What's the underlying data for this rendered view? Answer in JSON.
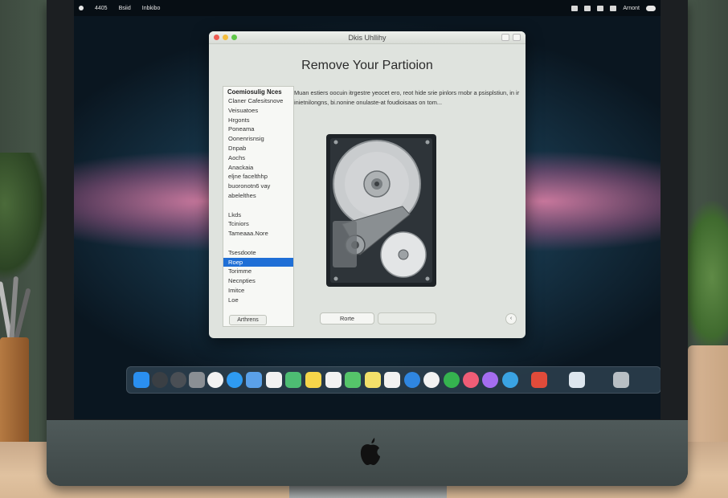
{
  "menubar": {
    "left_items": [
      "4405",
      "Bsiid",
      "Inbkibo"
    ],
    "right_text": "Arnont"
  },
  "window": {
    "title": "Dkis Uhllihy",
    "heading": "Remove Your Partioion",
    "description": "Muan estiers oocuin itrgestre yeocet ero, reot hide srie pinlors rnobr a psisplstiun, in ir inietnilongns, bi.nonine onulaste-at foudioisaas on tom...",
    "sidebar": {
      "header": "Coemiosulig Nces",
      "items": [
        "Claner Cafesitsnove",
        "Veisuatoes",
        "Hrgonts",
        "Poneama",
        "Oonenrisnsig",
        "Dnpab",
        "Aochs",
        "Anackaia",
        "eljne facelthhp",
        "buoronotn6 vay",
        "abelelthes",
        "",
        "Lkds",
        "Tciniors",
        "Tameaaa.Nore",
        "",
        "Tsesdoote",
        "Roep",
        "Torimme",
        "Necnpties",
        "Imitce",
        "Loe"
      ],
      "selected_index": 17,
      "bottom_button": "Arthrens"
    },
    "buttons": {
      "primary": "Rorte",
      "secondary": "",
      "round": "‹"
    }
  },
  "dock": {
    "icons": [
      "finder-icon",
      "siri-icon",
      "launchpad-icon",
      "pen-icon",
      "contacts-icon",
      "safari-icon",
      "mail-icon",
      "calendar-icon",
      "maps-icon",
      "notes-icon",
      "reminders-icon",
      "messages-icon",
      "stickies-icon",
      "photos-icon",
      "compass-icon",
      "chrome-icon",
      "spotify-icon",
      "itunes-icon",
      "music-icon",
      "app-icon",
      "news-icon",
      "preview-icon",
      "trash-icon"
    ]
  }
}
